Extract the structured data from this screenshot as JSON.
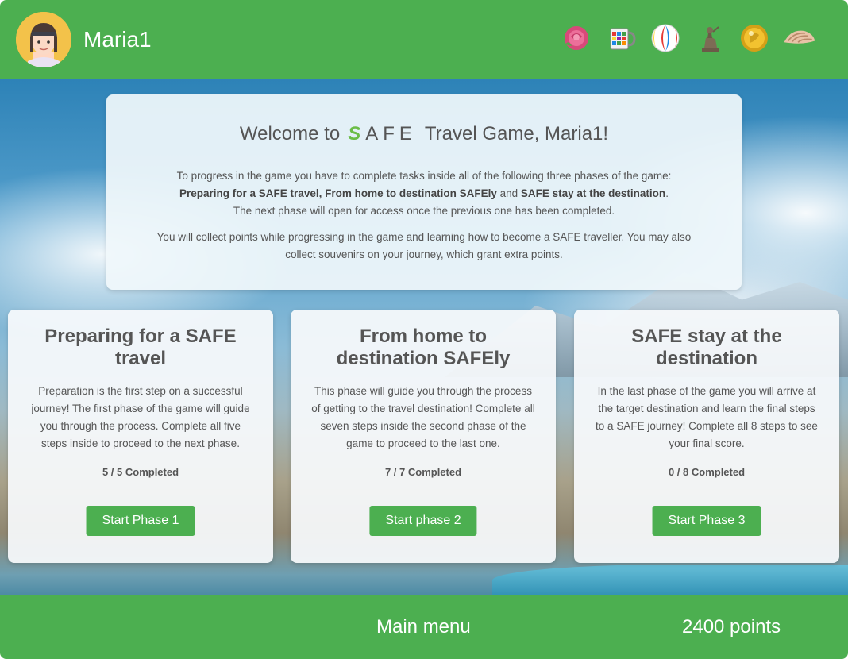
{
  "header": {
    "username": "Maria1",
    "souvenirs": [
      {
        "name": "rose-souvenir-icon"
      },
      {
        "name": "mug-souvenir-icon"
      },
      {
        "name": "beach-ball-souvenir-icon"
      },
      {
        "name": "statue-souvenir-icon"
      },
      {
        "name": "gold-coin-souvenir-icon"
      },
      {
        "name": "seashell-souvenir-icon"
      }
    ]
  },
  "welcome": {
    "title_prefix": "Welcome to",
    "logo_s": "S",
    "logo_rest": "AFE",
    "title_suffix": "Travel Game, Maria1!",
    "para1_line1": "To progress in the game you have to complete tasks inside all of the following three phases of the game:",
    "phase_names": [
      "Preparing for a SAFE travel, From home to destination SAFEly",
      "SAFE stay at the destination"
    ],
    "and_text": " and ",
    "period": ".",
    "para1_line3": "The next phase will open for access once the previous one has been completed.",
    "para2": "You will collect points while progressing in the game and learning how to become a SAFE traveller. You may also collect souvenirs on your journey, which grant extra points."
  },
  "phases": [
    {
      "title": "Preparing for a SAFE travel",
      "description": "Preparation is the first step on a successful journey! The first phase of the game will guide you through the process. Complete all five steps inside to proceed to the next phase.",
      "progress": "5 / 5 Completed",
      "button": "Start Phase 1"
    },
    {
      "title": "From home to destination SAFEly",
      "description": "This phase will guide you through the process of getting to the travel destination! Complete all seven steps inside the second phase of the game to proceed to the last one.",
      "progress": "7 / 7 Completed",
      "button": "Start phase 2"
    },
    {
      "title": "SAFE stay at the destination",
      "description": "In the last phase of the game you will arrive at the target destination and learn the final steps to a SAFE journey! Complete all 8 steps to see your final score.",
      "progress": "0 / 8 Completed",
      "button": "Start Phase 3"
    }
  ],
  "footer": {
    "menu_label": "Main menu",
    "points": "2400 points"
  },
  "colors": {
    "brand_green": "#4caf50",
    "logo_green": "#6bbd47"
  }
}
